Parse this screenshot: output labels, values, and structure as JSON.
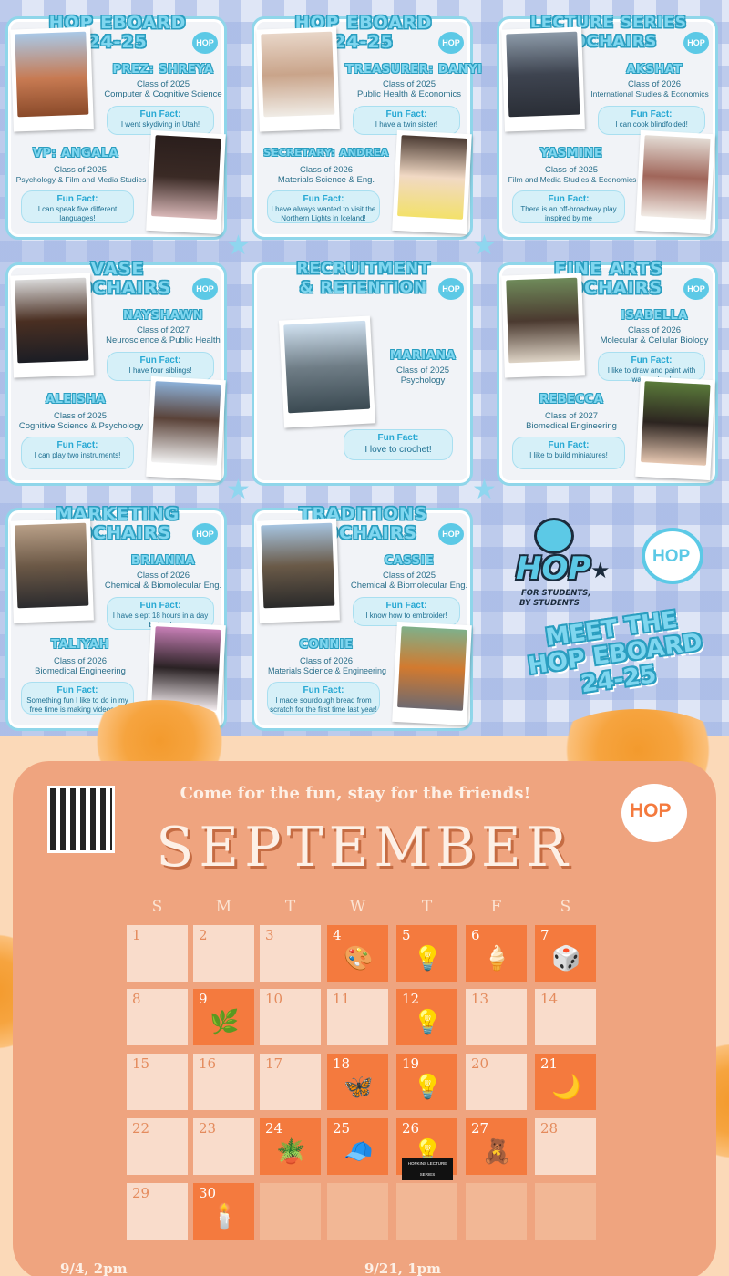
{
  "cards": [
    {
      "title1": "HOP EBOARD",
      "title2": "24-25",
      "hop": "HOP",
      "p1": {
        "name": "PREZ: SHREYA",
        "cls": "Class of 2025",
        "major": "Computer & Cognitive Science",
        "ff_label": "Fun Fact:",
        "ff_text": "I went skydiving in Utah!"
      },
      "p2": {
        "name": "VP: ANGALA",
        "cls": "Class of 2025",
        "major": "Psychology & Film and Media Studies",
        "ff_label": "Fun Fact:",
        "ff_text": "I can speak five different languages!"
      }
    },
    {
      "title1": "HOP EBOARD",
      "title2": "24-25",
      "hop": "HOP",
      "p1": {
        "name": "TREASURER: DANYI",
        "cls": "Class of 2025",
        "major": "Public Health & Economics",
        "ff_label": "Fun Fact:",
        "ff_text": "I have a twin sister!"
      },
      "p2": {
        "name": "SECRETARY: ANDREA",
        "cls": "Class of 2026",
        "major": "Materials Science & Eng.",
        "ff_label": "Fun Fact:",
        "ff_text": "I have always wanted to visit the Northern Lights in Iceland!"
      }
    },
    {
      "title1": "LECTURE SERIES",
      "title2": "COCHAIRS",
      "hop": "HOP",
      "p1": {
        "name": "AKSHAT",
        "cls": "Class of 2026",
        "major": "International Studies & Economics",
        "ff_label": "Fun Fact:",
        "ff_text": "I can cook blindfolded!"
      },
      "p2": {
        "name": "YASMINE",
        "cls": "Class of 2025",
        "major": "Film and Media Studies & Economics",
        "ff_label": "Fun Fact:",
        "ff_text": "There is an off-broadway play inspired by me"
      }
    },
    {
      "title1": "VASE",
      "title2": "COCHAIRS",
      "hop": "HOP",
      "p1": {
        "name": "NAYSHAWN",
        "cls": "Class of 2027",
        "major": "Neuroscience & Public Health",
        "ff_label": "Fun Fact:",
        "ff_text": "I have four siblings!"
      },
      "p2": {
        "name": "ALEISHA",
        "cls": "Class of 2025",
        "major": "Cognitive Science & Psychology",
        "ff_label": "Fun Fact:",
        "ff_text": "I can play two instruments!"
      }
    },
    {
      "title1": "RECRUITMENT",
      "title2": "& RETENTION",
      "hop": "HOP",
      "p1": {
        "name": "MARIANA",
        "cls": "Class of 2025",
        "major": "Psychology",
        "ff_label": "Fun Fact:",
        "ff_text": "I love to crochet!"
      }
    },
    {
      "title1": "FINE ARTS",
      "title2": "COCHAIRS",
      "hop": "HOP",
      "p1": {
        "name": "ISABELLA",
        "cls": "Class of 2026",
        "major": "Molecular & Cellular Biology",
        "ff_label": "Fun Fact:",
        "ff_text": "I like to draw and paint with watercolors!"
      },
      "p2": {
        "name": "REBECCA",
        "cls": "Class of 2027",
        "major": "Biomedical Engineering",
        "ff_label": "Fun Fact:",
        "ff_text": "I like to build miniatures!"
      }
    },
    {
      "title1": "MARKETING",
      "title2": "COCHAIRS",
      "hop": "HOP",
      "p1": {
        "name": "BRIANNA",
        "cls": "Class of 2026",
        "major": "Chemical & Biomolecular Eng.",
        "ff_label": "Fun Fact:",
        "ff_text": "I have slept 18 hours in a day before!"
      },
      "p2": {
        "name": "TALIYAH",
        "cls": "Class of 2026",
        "major": "Biomedical Engineering",
        "ff_label": "Fun Fact:",
        "ff_text": "Something fun I like to do in my free time is making videos 😀"
      }
    },
    {
      "title1": "TRADITIONS",
      "title2": "COCHAIRS",
      "hop": "HOP",
      "p1": {
        "name": "CASSIE",
        "cls": "Class of 2025",
        "major": "Chemical & Biomolecular Eng.",
        "ff_label": "Fun Fact:",
        "ff_text": "I know how to embroider!"
      },
      "p2": {
        "name": "CONNIE",
        "cls": "Class of 2026",
        "major": "Materials Science & Engineering",
        "ff_label": "Fun Fact:",
        "ff_text": "I made sourdough bread from scratch for the first time last year!"
      }
    }
  ],
  "logo": {
    "hop": "HOP",
    "tag1": "FOR STUDENTS,",
    "tag2": "BY STUDENTS",
    "bubble": "HOP"
  },
  "meet": {
    "l1": "MEET THE",
    "l2": "HOP EBOARD",
    "l3": "24-25"
  },
  "calendar": {
    "tagline": "Come for the fun, stay for the friends!",
    "month": "SEPTEMBER",
    "hop": "HOP",
    "dows": [
      "S",
      "M",
      "T",
      "W",
      "T",
      "F",
      "S"
    ],
    "days": [
      {
        "n": "1",
        "ev": false,
        "icon": ""
      },
      {
        "n": "2",
        "ev": false,
        "icon": ""
      },
      {
        "n": "3",
        "ev": false,
        "icon": ""
      },
      {
        "n": "4",
        "ev": true,
        "icon": "🎨"
      },
      {
        "n": "5",
        "ev": true,
        "icon": "💡"
      },
      {
        "n": "6",
        "ev": true,
        "icon": "🍦"
      },
      {
        "n": "7",
        "ev": true,
        "icon": "🎲"
      },
      {
        "n": "8",
        "ev": false,
        "icon": ""
      },
      {
        "n": "9",
        "ev": true,
        "icon": "🌿"
      },
      {
        "n": "10",
        "ev": false,
        "icon": ""
      },
      {
        "n": "11",
        "ev": false,
        "icon": ""
      },
      {
        "n": "12",
        "ev": true,
        "icon": "💡"
      },
      {
        "n": "13",
        "ev": false,
        "icon": ""
      },
      {
        "n": "14",
        "ev": false,
        "icon": ""
      },
      {
        "n": "15",
        "ev": false,
        "icon": ""
      },
      {
        "n": "16",
        "ev": false,
        "icon": ""
      },
      {
        "n": "17",
        "ev": false,
        "icon": ""
      },
      {
        "n": "18",
        "ev": true,
        "icon": "🦋"
      },
      {
        "n": "19",
        "ev": true,
        "icon": "💡"
      },
      {
        "n": "20",
        "ev": false,
        "icon": ""
      },
      {
        "n": "21",
        "ev": true,
        "icon": "🌙"
      },
      {
        "n": "22",
        "ev": false,
        "icon": ""
      },
      {
        "n": "23",
        "ev": false,
        "icon": ""
      },
      {
        "n": "24",
        "ev": true,
        "icon": "🪴"
      },
      {
        "n": "25",
        "ev": true,
        "icon": "🧢"
      },
      {
        "n": "26",
        "ev": true,
        "icon": "💡"
      },
      {
        "n": "27",
        "ev": true,
        "icon": "🧸"
      },
      {
        "n": "28",
        "ev": false,
        "icon": ""
      },
      {
        "n": "29",
        "ev": false,
        "icon": ""
      },
      {
        "n": "30",
        "ev": true,
        "icon": "🕯️"
      }
    ],
    "lecture_label": "HOPKINS LECTURE SERIES",
    "note1": "9/4, 2pm",
    "note2": "9/21, 1pm"
  }
}
